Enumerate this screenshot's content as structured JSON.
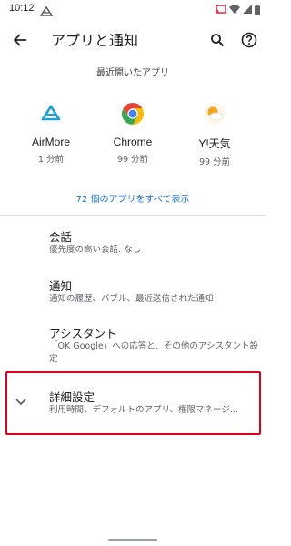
{
  "status_bar": {
    "time": "10:12",
    "icons": [
      "cast-icon",
      "wifi-icon",
      "signal-icon",
      "battery-icon"
    ]
  },
  "app_bar": {
    "title": "アプリと通知",
    "icons": [
      "back-arrow-icon",
      "search-icon",
      "help-icon"
    ]
  },
  "recent_apps": {
    "header": "最近開いたアプリ",
    "items": [
      {
        "name": "AirMore",
        "time": "1 分前",
        "icon": "airmore-icon"
      },
      {
        "name": "Chrome",
        "time": "99 分前",
        "icon": "chrome-icon"
      },
      {
        "name": "Y!天気",
        "time": "99 分前",
        "icon": "yahoo-weather-icon"
      }
    ],
    "see_all": "72 個のアプリをすべて表示"
  },
  "settings": {
    "conversations": {
      "title": "会話",
      "subtitle": "優先度の高い会話: なし"
    },
    "notifications": {
      "title": "通知",
      "subtitle": "通知の履歴、バブル、最近送信された通知"
    },
    "assistant": {
      "title": "アシスタント",
      "subtitle": "「OK Google」への応答と、その他のアシスタント設定"
    },
    "advanced": {
      "title": "詳細設定",
      "subtitle": "利用時間、デフォルトのアプリ、権限マネージ..."
    }
  },
  "colors": {
    "accent": "#1a73e8",
    "highlight_box": "#e0001b"
  }
}
